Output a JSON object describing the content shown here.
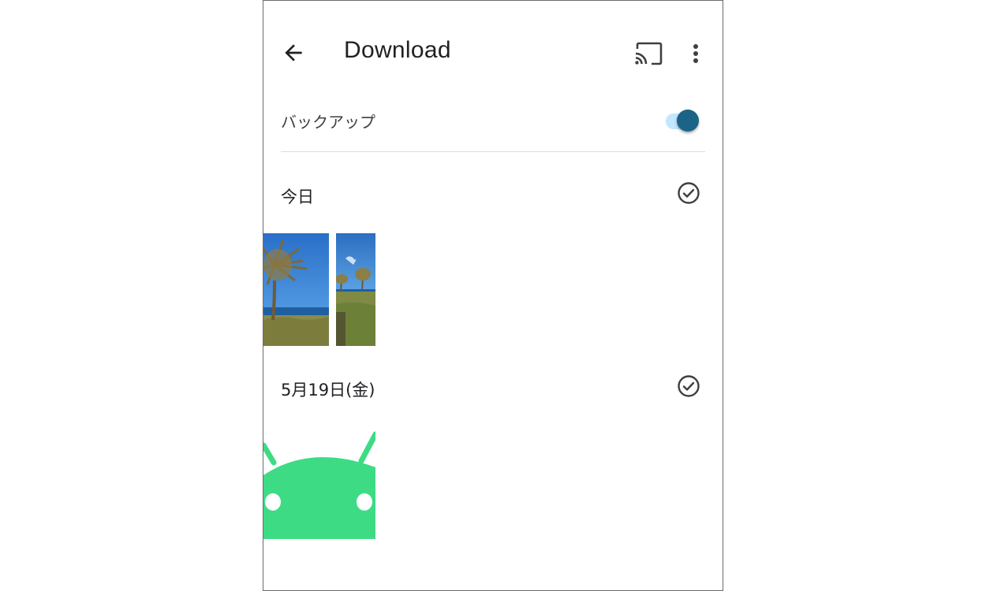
{
  "header": {
    "title": "Download",
    "back_icon": "arrow-back-icon",
    "cast_icon": "cast-icon",
    "more_icon": "more-vert-icon"
  },
  "backup": {
    "label": "バックアップ",
    "enabled": true,
    "accent_color": "#1b6487",
    "track_color": "#c2e7ff"
  },
  "sections": [
    {
      "label": "今日",
      "select_icon": "check-circle-icon",
      "photos": [
        {
          "description": "Palm tree by the ocean under blue sky"
        },
        {
          "description": "Palm trees on grassy field under blue sky"
        }
      ]
    },
    {
      "label": "5月19日(金)",
      "select_icon": "check-circle-icon",
      "photos": [
        {
          "description": "Green Android robot head"
        }
      ]
    }
  ],
  "colors": {
    "android_green": "#3ddc84",
    "text_primary": "#202124",
    "divider": "#dadce0"
  }
}
